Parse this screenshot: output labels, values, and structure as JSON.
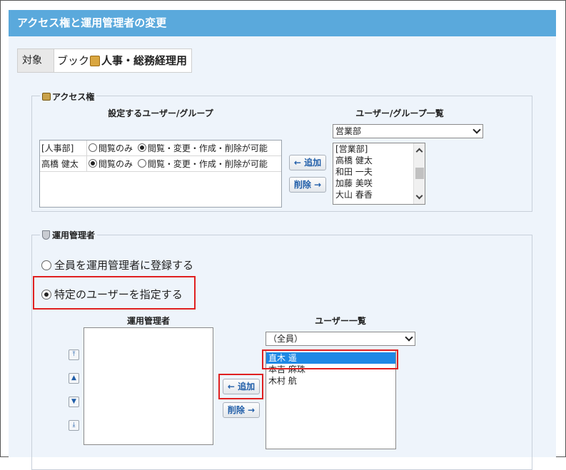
{
  "page": {
    "title": "アクセス権と運用管理者の変更"
  },
  "target": {
    "label": "対象",
    "type": "ブック",
    "name": "人事・総務経理用"
  },
  "access": {
    "legend": "アクセス権",
    "left_header": "設定するユーザー/グループ",
    "right_header": "ユーザー/グループ一覧",
    "rows": [
      {
        "name": "[人事部]",
        "opt1": "閲覧のみ",
        "opt2": "閲覧・変更・作成・削除が可能",
        "selected": 2
      },
      {
        "name": "高橋 健太",
        "opt1": "閲覧のみ",
        "opt2": "閲覧・変更・作成・削除が可能",
        "selected": 1
      }
    ],
    "add_label": "← 追加",
    "remove_label": "削除 →",
    "group_select": "営業部",
    "list_items": [
      "[営業部]",
      "高橋 健太",
      "和田 一夫",
      "加藤 美咲",
      "大山 春香"
    ]
  },
  "admin": {
    "legend": "運用管理者",
    "option_all": "全員を運用管理者に登録する",
    "option_specific": "特定のユーザーを指定する",
    "selected_option": "specific",
    "left_header": "運用管理者",
    "right_header": "ユーザー一覧",
    "add_label": "← 追加",
    "remove_label": "削除 →",
    "group_select": "（全員）",
    "users": [
      "直木 遥",
      "本吉 麻珠",
      "木村 航"
    ],
    "order_buttons": [
      "top-icon",
      "up-icon",
      "down-icon",
      "bottom-icon"
    ]
  },
  "colors": {
    "titlebar": "#5aa9dc",
    "highlight": "#e02020",
    "selected_row": "#1e88e5",
    "button_text": "#1f5da8"
  }
}
